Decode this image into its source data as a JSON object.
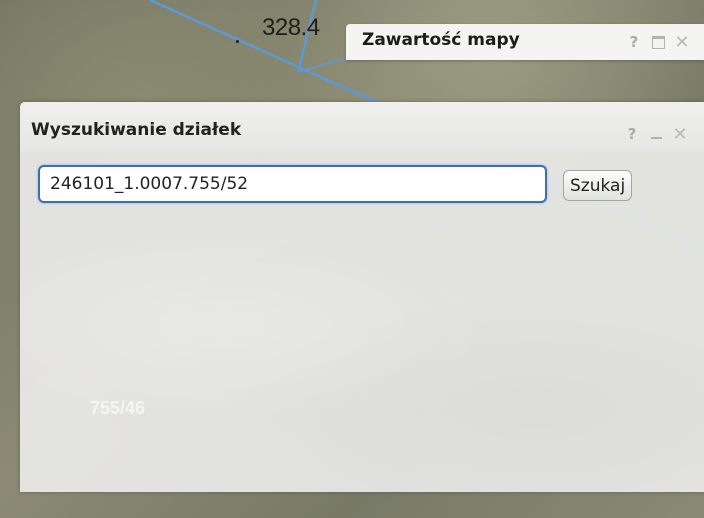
{
  "map": {
    "parcel_label": "328.4",
    "ghost_parcel_label": "755/46",
    "line_color": "#5b9bd5"
  },
  "map_content_panel": {
    "title": "Zawartość mapy",
    "help_label": "?",
    "close_label": "✕",
    "icons": [
      "help-icon",
      "restore-icon",
      "close-icon"
    ]
  },
  "search_window": {
    "title": "Wyszukiwanie działek",
    "help_label": "?",
    "close_label": "✕",
    "icons": [
      "help-icon",
      "minimize-icon",
      "close-icon"
    ],
    "input": {
      "value": "246101_1.0007.755/52",
      "placeholder": ""
    },
    "search_button_label": "Szukaj",
    "accent_color": "#3c6fb6"
  }
}
